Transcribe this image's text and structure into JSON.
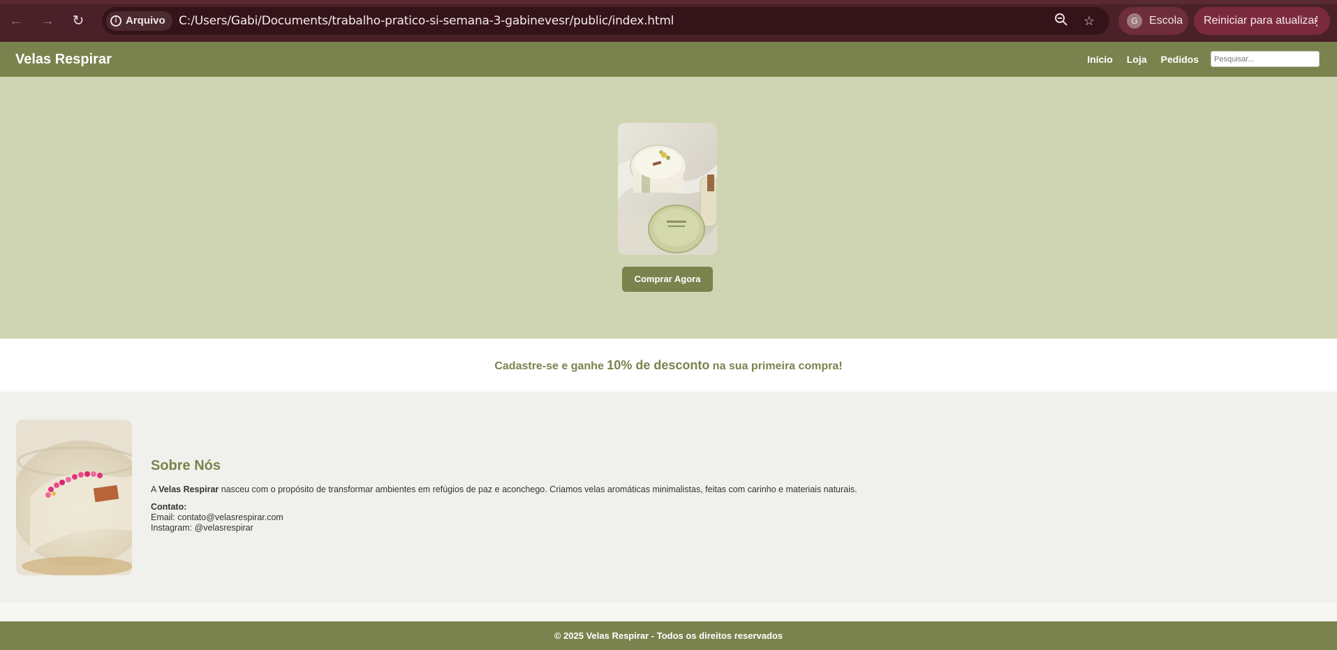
{
  "browser": {
    "site_chip": "Arquivo",
    "url": "C:/Users/Gabi/Documents/trabalho-pratico-si-semana-3-gabinevesr/public/index.html",
    "profile_initial": "G",
    "profile_name": "Escola",
    "update_label": "Reiniciar para atualizar",
    "icons": [
      "back-arrow-icon",
      "forward-arrow-icon",
      "reload-icon",
      "info-icon",
      "zoom-out-icon",
      "star-icon",
      "kebab-menu-icon"
    ]
  },
  "header": {
    "brand": "Velas Respirar",
    "nav": [
      {
        "label": "Início"
      },
      {
        "label": "Loja"
      },
      {
        "label": "Pedidos"
      }
    ],
    "search_placeholder": "Pesquisar..."
  },
  "hero": {
    "button_label": "Comprar Agora"
  },
  "promo": {
    "prefix": "Cadastre-se e ganhe ",
    "highlight": "10% de desconto",
    "suffix": " na sua primeira compra!"
  },
  "about": {
    "title": "Sobre Nós",
    "text_prefix": "A ",
    "brand_bold": "Velas Respirar",
    "text_suffix": " nasceu com o propósito de transformar ambientes em refúgios de paz e aconchego. Criamos velas aromáticas minimalistas, feitas com carinho e materiais naturais.",
    "contact_label": "Contato:",
    "email_line": "Email: contato@velasrespirar.com",
    "instagram_line": "Instagram: @velasrespirar"
  },
  "footer": {
    "text": "© 2025 Velas Respirar - Todos os direitos reservados"
  },
  "colors": {
    "chrome": "#4a2129",
    "header": "#7a834d",
    "hero_bg": "#cfd5b2",
    "about_bg": "#f0f1ec",
    "accent": "#7a834d"
  }
}
